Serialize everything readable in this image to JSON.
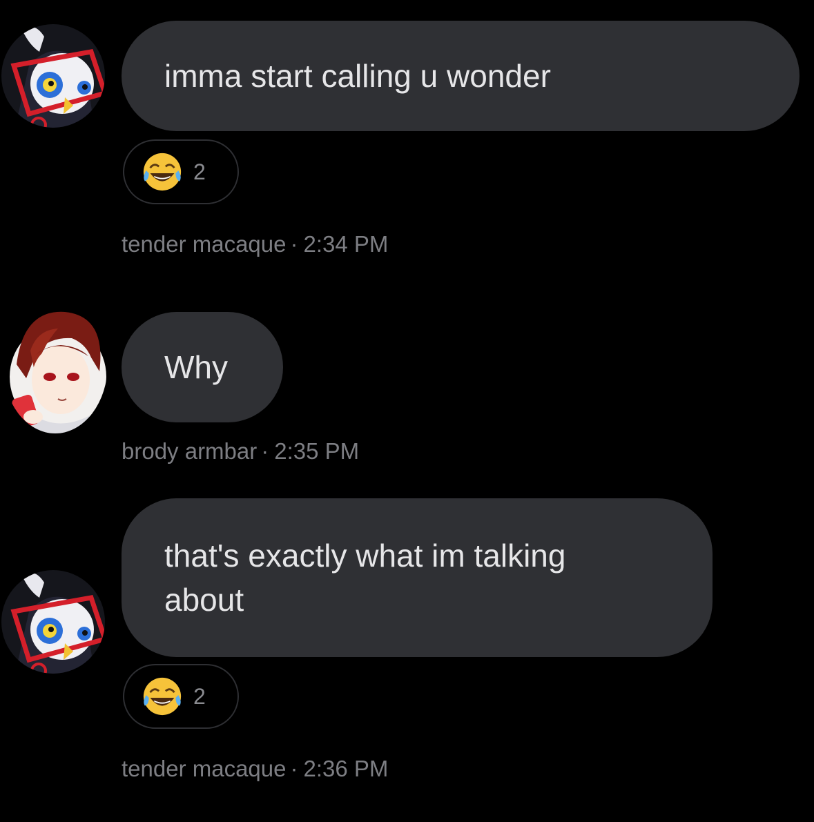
{
  "messages": [
    {
      "text": "imma start calling u wonder",
      "author": "tender macaque",
      "separator": "·",
      "time": "2:34 PM",
      "reaction": {
        "emoji": "laughing-tears-emoji",
        "count": "2"
      }
    },
    {
      "text": "Why",
      "author": "brody armbar",
      "separator": "·",
      "time": "2:35 PM"
    },
    {
      "text": "that's exactly what im talking\nabout",
      "author": "tender macaque",
      "separator": "·",
      "time": "2:36 PM",
      "reaction": {
        "emoji": "laughing-tears-emoji",
        "count": "2"
      }
    }
  ],
  "colors": {
    "background": "#000000",
    "bubble": "#2f3034",
    "bubble_text": "#e6e6e8",
    "meta_text": "#7d7e83"
  }
}
